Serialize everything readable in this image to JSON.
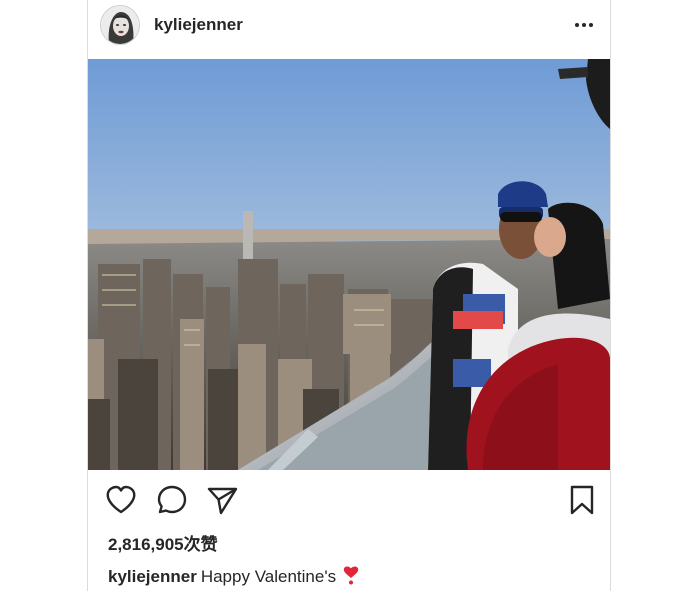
{
  "post": {
    "username": "kyliejenner",
    "likes": "2,816,905次赞",
    "caption": {
      "username": "kyliejenner",
      "text": "Happy Valentine's"
    }
  },
  "icons": {
    "more": "more-horizontal-icon",
    "like": "heart-outline-icon",
    "comment": "comment-bubble-icon",
    "share": "paper-plane-icon",
    "save": "bookmark-icon",
    "caption_emoji": "red-heart-exclamation-icon"
  },
  "colors": {
    "text": "#262626",
    "border": "#dbdbdb",
    "heart_emoji": "#e0263a"
  }
}
